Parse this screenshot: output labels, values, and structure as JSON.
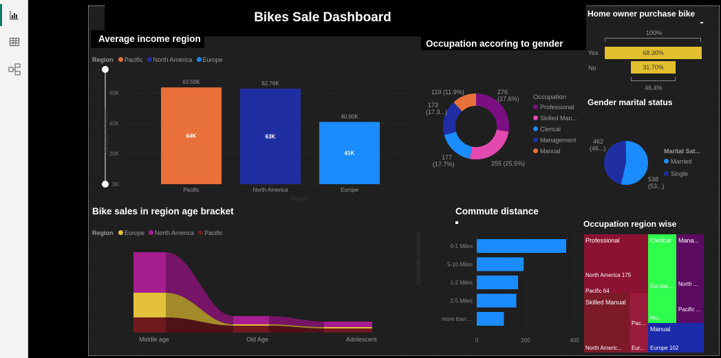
{
  "dashboard_title": "Bikes Sale Dashboard",
  "nav": {
    "icons": [
      "report-view-icon",
      "table-view-icon",
      "model-view-icon"
    ]
  },
  "avg_income": {
    "title": "Average income region",
    "legend_label": "Region",
    "legend": [
      {
        "name": "Pacific",
        "color": "#e8703a"
      },
      {
        "name": "North America",
        "color": "#1f2fa3"
      },
      {
        "name": "Europe",
        "color": "#1a8cff"
      }
    ],
    "yticks": [
      "0K",
      "20K",
      "40K",
      "60K"
    ],
    "ylabel": "Average of Income",
    "xlabel": "Region",
    "bars": [
      {
        "cat": "Pacific",
        "top": "63.59K",
        "inner": "64K"
      },
      {
        "cat": "North America",
        "top": "62.76K",
        "inner": "63K"
      },
      {
        "cat": "Europe",
        "top": "40.90K",
        "inner": "41K"
      }
    ]
  },
  "occupation_gender": {
    "title": "Occupation accoring to gender",
    "legend_title": "Occupation",
    "legend": [
      "Professional",
      "Skilled Man...",
      "Clerical",
      "Management",
      "Manual"
    ],
    "labels": {
      "a": "276",
      "a2": "(27.6%)",
      "b": "255 (25.5%)",
      "c": "177",
      "c2": "(17.7%)",
      "d": "173",
      "d2": "(17.3...)",
      "e": "119 (11.9%)"
    }
  },
  "home_owner": {
    "title": "Home owner purchase bike",
    "top": "100%",
    "bottom": "46.4%",
    "rows": [
      {
        "label": "Yes",
        "value": "68.30%"
      },
      {
        "label": "No",
        "value": "31.70%"
      }
    ]
  },
  "gender_marital": {
    "title": "Gender marital status",
    "legend_title": "Marital Sat...",
    "legend": [
      "Married",
      "Single"
    ],
    "labels": {
      "a": "462",
      "a2": "(46...)",
      "b": "538",
      "b2": "(53...)"
    }
  },
  "age_bracket": {
    "title": "Bike sales in region age bracket",
    "legend_label": "Region",
    "legend": [
      {
        "name": "Europe",
        "color": "#e3c13b"
      },
      {
        "name": "North America",
        "color": "#a61d8f"
      },
      {
        "name": "Pacific",
        "color": "#6e1a1f"
      }
    ],
    "categories": [
      "Middle age",
      "Old Age",
      "Adolescent"
    ]
  },
  "commute": {
    "title": "Commute distance",
    "ylabel": "Commute Distance",
    "categories": [
      "0-1 Miles",
      "5-10 Miles",
      "1-2 Miles",
      "2-5 Miles",
      "more than ..."
    ],
    "xticks": [
      "0",
      "200",
      "400"
    ]
  },
  "occ_region": {
    "title": "Occupation region wise",
    "cells": {
      "professional": "Professional",
      "na175": "North America 175",
      "pac64": "Pacific 64",
      "skilled": "Skilled Manual",
      "nam": "North Americ...",
      "eur": "Eur...",
      "pac": "Pac...",
      "clerical": "Clerical",
      "europe": "Europe...",
      "no": "No...",
      "mana": "Mana...",
      "north": "North ...",
      "pacific": "Pacific ...",
      "manual": "Manual",
      "europe102": "Europe 102"
    }
  },
  "chart_data": [
    {
      "type": "bar",
      "title": "Average income region",
      "categories": [
        "Pacific",
        "North America",
        "Europe"
      ],
      "values": [
        63590,
        62760,
        40900
      ],
      "ylabel": "Average of Income",
      "xlabel": "Region",
      "ylim": [
        0,
        70000
      ]
    },
    {
      "type": "pie",
      "title": "Occupation accoring to gender",
      "categories": [
        "Professional",
        "Skilled Manual",
        "Clerical",
        "Management",
        "Manual"
      ],
      "values": [
        276,
        255,
        177,
        173,
        119
      ]
    },
    {
      "type": "pie",
      "title": "Gender marital status",
      "categories": [
        "Married",
        "Single"
      ],
      "values": [
        462,
        538
      ]
    },
    {
      "type": "bar",
      "title": "Home owner purchase bike",
      "categories": [
        "Yes",
        "No"
      ],
      "values": [
        68.3,
        31.7
      ]
    },
    {
      "type": "bar",
      "title": "Commute distance",
      "categories": [
        "0-1 Miles",
        "5-10 Miles",
        "1-2 Miles",
        "2-5 Miles",
        "more than ..."
      ],
      "values": [
        366,
        192,
        169,
        162,
        111
      ],
      "xlim": [
        0,
        400
      ]
    }
  ]
}
